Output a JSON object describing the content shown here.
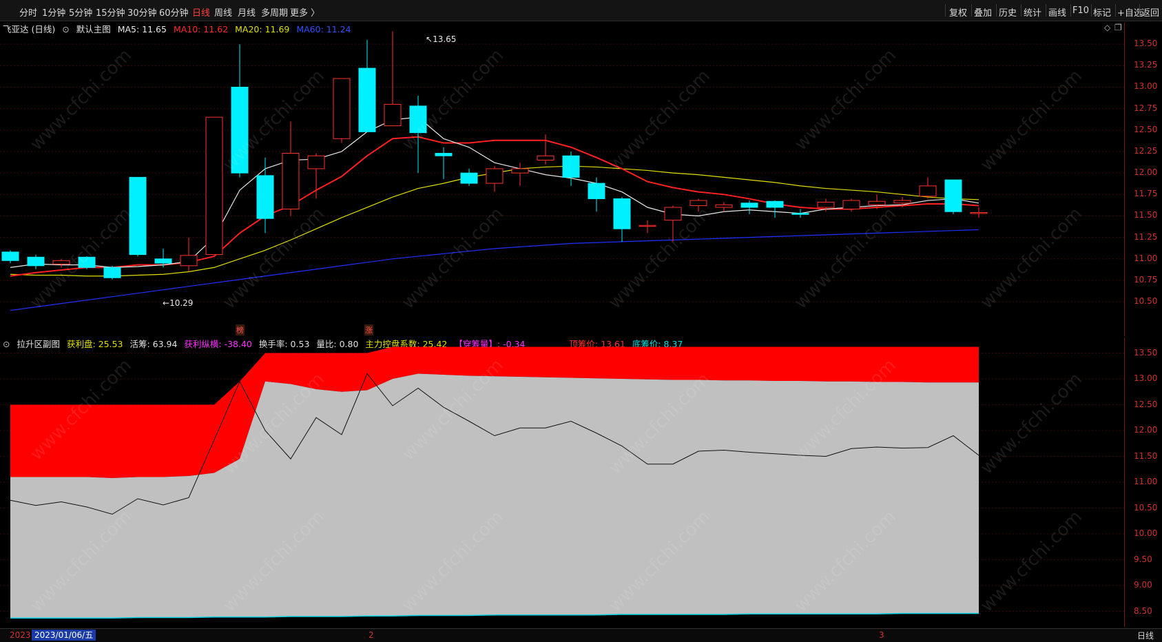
{
  "toolbar": {
    "periods": [
      "分时",
      "1分钟",
      "5分钟",
      "15分钟",
      "30分钟",
      "60分钟",
      "日线",
      "周线",
      "月线",
      "多周期",
      "更多 〉"
    ],
    "active_period": "日线",
    "right_buttons": [
      "复权",
      "叠加",
      "历史",
      "统计",
      "画线",
      "F10",
      "标记",
      "+自选",
      "返回"
    ]
  },
  "main_info": {
    "stock": "飞亚达 (日线)",
    "template": "默认主图",
    "ma5": "MA5: 11.65",
    "ma10": "MA10: 11.62",
    "ma20": "MA20: 11.69",
    "ma60": "MA60: 11.24"
  },
  "sub_info": {
    "name": "拉升区副图",
    "profit_chips": "获利盘: 25.53",
    "active_chips": "活筹: 63.94",
    "profit_depth": "获利纵横: -38.40",
    "turnover": "换手率: 0.53",
    "volume_ratio": "量比: 0.80",
    "control": "主力控盘系数: 25.42",
    "chip_pass": "【穿筹量】: -0.34",
    "top_price": "顶筹价: 13.61",
    "bottom_price": "底筹价: 8.37"
  },
  "markers": {
    "high_label": "13.65",
    "low_label": "10.29",
    "tag1": "榜",
    "tag2": "涨"
  },
  "colors": {
    "up": "#ff3030",
    "down": "#00f0ff",
    "ma5": "#e8e8e8",
    "ma10": "#ff2020",
    "ma20": "#e0e000",
    "ma60": "#2030ff",
    "chip_red": "#ff0000",
    "chip_grey": "#c0c0c0"
  },
  "bottom": {
    "year": "2023",
    "date": "2023/01/06/五",
    "tick2": "2",
    "tick3": "3",
    "period": "日线"
  },
  "watermark": "www.cfchi.com",
  "main_axis": [
    "13.50",
    "13.25",
    "13.00",
    "12.75",
    "12.50",
    "12.25",
    "12.00",
    "11.75",
    "11.50",
    "11.25",
    "11.00",
    "10.75",
    "10.50"
  ],
  "sub_axis": [
    "13.50",
    "13.00",
    "12.50",
    "12.00",
    "11.50",
    "11.00",
    "10.50",
    "10.00",
    "9.50",
    "9.00",
    "8.50"
  ],
  "chart_data": {
    "type": "candlestick",
    "candles": [
      {
        "o": 11.08,
        "c": 10.98,
        "h": 11.1,
        "l": 10.95
      },
      {
        "o": 11.02,
        "c": 10.92,
        "h": 11.05,
        "l": 10.88
      },
      {
        "o": 10.94,
        "c": 10.98,
        "h": 11.0,
        "l": 10.9
      },
      {
        "o": 11.02,
        "c": 10.9,
        "h": 11.03,
        "l": 10.88
      },
      {
        "o": 10.9,
        "c": 10.78,
        "h": 10.92,
        "l": 10.76
      },
      {
        "o": 11.95,
        "c": 11.05,
        "h": 11.95,
        "l": 11.03
      },
      {
        "o": 11.0,
        "c": 10.95,
        "h": 11.12,
        "l": 10.9
      },
      {
        "o": 10.92,
        "c": 11.04,
        "h": 11.25,
        "l": 10.85
      },
      {
        "o": 11.05,
        "c": 12.65,
        "h": 12.65,
        "l": 11.05
      },
      {
        "o": 13.0,
        "c": 12.0,
        "h": 13.5,
        "l": 11.95
      },
      {
        "o": 11.97,
        "c": 11.47,
        "h": 12.18,
        "l": 11.3
      },
      {
        "o": 11.58,
        "c": 12.23,
        "h": 12.6,
        "l": 11.5
      },
      {
        "o": 12.05,
        "c": 12.2,
        "h": 12.23,
        "l": 11.7
      },
      {
        "o": 12.4,
        "c": 13.1,
        "h": 13.1,
        "l": 12.35
      },
      {
        "o": 13.22,
        "c": 12.48,
        "h": 13.55,
        "l": 12.48
      },
      {
        "o": 12.55,
        "c": 12.8,
        "h": 13.65,
        "l": 12.55
      },
      {
        "o": 12.78,
        "c": 12.47,
        "h": 12.9,
        "l": 12.0
      },
      {
        "o": 12.23,
        "c": 12.2,
        "h": 12.3,
        "l": 11.93
      },
      {
        "o": 12.0,
        "c": 11.88,
        "h": 12.05,
        "l": 11.85
      },
      {
        "o": 11.88,
        "c": 12.05,
        "h": 12.08,
        "l": 11.78
      },
      {
        "o": 12.0,
        "c": 12.05,
        "h": 12.12,
        "l": 11.85
      },
      {
        "o": 12.15,
        "c": 12.2,
        "h": 12.45,
        "l": 12.1
      },
      {
        "o": 12.2,
        "c": 11.95,
        "h": 12.25,
        "l": 11.85
      },
      {
        "o": 11.88,
        "c": 11.7,
        "h": 11.95,
        "l": 11.55
      },
      {
        "o": 11.7,
        "c": 11.35,
        "h": 11.72,
        "l": 11.2
      },
      {
        "o": 11.38,
        "c": 11.39,
        "h": 11.45,
        "l": 11.3
      },
      {
        "o": 11.45,
        "c": 11.6,
        "h": 11.62,
        "l": 11.2
      },
      {
        "o": 11.62,
        "c": 11.68,
        "h": 11.7,
        "l": 11.55
      },
      {
        "o": 11.6,
        "c": 11.63,
        "h": 11.66,
        "l": 11.55
      },
      {
        "o": 11.65,
        "c": 11.6,
        "h": 11.68,
        "l": 11.52
      },
      {
        "o": 11.67,
        "c": 11.6,
        "h": 11.68,
        "l": 11.48
      },
      {
        "o": 11.53,
        "c": 11.52,
        "h": 11.58,
        "l": 11.48
      },
      {
        "o": 11.6,
        "c": 11.66,
        "h": 11.7,
        "l": 11.55
      },
      {
        "o": 11.58,
        "c": 11.68,
        "h": 11.7,
        "l": 11.55
      },
      {
        "o": 11.63,
        "c": 11.67,
        "h": 11.75,
        "l": 11.58
      },
      {
        "o": 11.65,
        "c": 11.68,
        "h": 11.72,
        "l": 11.6
      },
      {
        "o": 11.73,
        "c": 11.85,
        "h": 11.95,
        "l": 11.7
      },
      {
        "o": 11.92,
        "c": 11.55,
        "h": 11.92,
        "l": 11.52
      },
      {
        "o": 11.53,
        "c": 11.54,
        "h": 11.6,
        "l": 11.48
      }
    ],
    "ma5": [
      10.9,
      10.94,
      10.93,
      10.93,
      10.9,
      10.91,
      10.93,
      10.97,
      11.25,
      11.8,
      12.05,
      12.15,
      12.16,
      12.25,
      12.48,
      12.62,
      12.65,
      12.4,
      12.3,
      12.12,
      12.05,
      11.98,
      11.94,
      11.88,
      11.78,
      11.6,
      11.52,
      11.5,
      11.55,
      11.57,
      11.55,
      11.53,
      11.58,
      11.6,
      11.62,
      11.63,
      11.68,
      11.7,
      11.65
    ],
    "ma10": [
      10.8,
      10.84,
      10.87,
      10.9,
      10.9,
      10.93,
      10.93,
      10.96,
      11.03,
      11.3,
      11.5,
      11.62,
      11.8,
      11.96,
      12.2,
      12.4,
      12.42,
      12.35,
      12.35,
      12.38,
      12.38,
      12.38,
      12.3,
      12.18,
      12.05,
      11.9,
      11.83,
      11.78,
      11.75,
      11.7,
      11.64,
      11.6,
      11.58,
      11.58,
      11.6,
      11.62,
      11.64,
      11.64,
      11.62
    ],
    "ma20": [
      10.82,
      10.81,
      10.81,
      10.8,
      10.8,
      10.81,
      10.82,
      10.85,
      10.9,
      11.0,
      11.1,
      11.22,
      11.35,
      11.48,
      11.6,
      11.72,
      11.82,
      11.88,
      11.95,
      12.0,
      12.05,
      12.07,
      12.08,
      12.07,
      12.05,
      12.03,
      12.0,
      11.98,
      11.95,
      11.92,
      11.89,
      11.85,
      11.82,
      11.8,
      11.78,
      11.75,
      11.72,
      11.7,
      11.69
    ],
    "ma60": [
      10.4,
      10.44,
      10.48,
      10.52,
      10.56,
      10.6,
      10.64,
      10.68,
      10.72,
      10.76,
      10.8,
      10.84,
      10.88,
      10.92,
      10.96,
      11.0,
      11.03,
      11.06,
      11.09,
      11.12,
      11.14,
      11.16,
      11.18,
      11.19,
      11.2,
      11.21,
      11.22,
      11.23,
      11.24,
      11.25,
      11.26,
      11.27,
      11.28,
      11.29,
      11.3,
      11.31,
      11.32,
      11.33,
      11.34
    ],
    "y_range": [
      10.1,
      13.75
    ],
    "sub_chart": {
      "type": "area",
      "y_range": [
        8.2,
        13.8
      ],
      "top_red": [
        12.5,
        12.5,
        12.5,
        12.5,
        12.5,
        12.5,
        12.5,
        12.5,
        12.5,
        12.95,
        13.5,
        13.5,
        13.5,
        13.5,
        13.5,
        13.62,
        13.62,
        13.62,
        13.62,
        13.62,
        13.62,
        13.62,
        13.62,
        13.62,
        13.62,
        13.62,
        13.62,
        13.62,
        13.62,
        13.62,
        13.62,
        13.62,
        13.62,
        13.62,
        13.62,
        13.62,
        13.62,
        13.62,
        13.62
      ],
      "grey_top": [
        11.1,
        11.1,
        11.1,
        11.1,
        11.08,
        11.1,
        11.1,
        11.12,
        11.18,
        11.45,
        12.95,
        12.9,
        12.8,
        12.75,
        12.78,
        13.0,
        13.1,
        13.08,
        13.06,
        13.05,
        13.04,
        13.03,
        13.02,
        13.01,
        13.0,
        12.99,
        12.98,
        12.98,
        12.97,
        12.97,
        12.96,
        12.96,
        12.95,
        12.95,
        12.94,
        12.94,
        12.93,
        12.93,
        12.93
      ],
      "grey_bottom": [
        8.37,
        8.37,
        8.37,
        8.37,
        8.37,
        8.38,
        8.38,
        8.38,
        8.39,
        8.39,
        8.39,
        8.4,
        8.4,
        8.4,
        8.41,
        8.41,
        8.42,
        8.42,
        8.42,
        8.43,
        8.43,
        8.43,
        8.43,
        8.43,
        8.44,
        8.44,
        8.44,
        8.44,
        8.44,
        8.45,
        8.45,
        8.45,
        8.45,
        8.45,
        8.45,
        8.46,
        8.46,
        8.46,
        8.46
      ],
      "price_line": [
        10.65,
        10.55,
        10.62,
        10.52,
        10.38,
        10.68,
        10.56,
        10.7,
        11.82,
        12.95,
        12.0,
        11.45,
        12.25,
        11.92,
        13.1,
        12.48,
        12.82,
        12.45,
        12.18,
        11.9,
        12.05,
        12.05,
        12.18,
        11.95,
        11.7,
        11.35,
        11.35,
        11.6,
        11.62,
        11.58,
        11.55,
        11.52,
        11.5,
        11.65,
        11.68,
        11.66,
        11.67,
        11.9,
        11.52
      ]
    }
  }
}
